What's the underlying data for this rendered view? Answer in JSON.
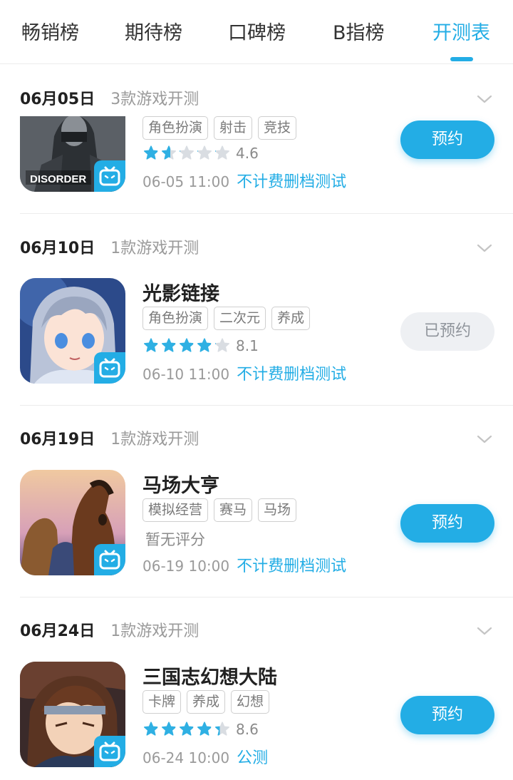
{
  "tabs": [
    {
      "label": "畅销榜",
      "active": false
    },
    {
      "label": "期待榜",
      "active": false
    },
    {
      "label": "口碑榜",
      "active": false
    },
    {
      "label": "B指榜",
      "active": false
    },
    {
      "label": "开测表",
      "active": true
    }
  ],
  "colors": {
    "accent": "#23ade5",
    "star_filled": "#2fb0e3",
    "star_empty": "#d9dde2"
  },
  "sections": [
    {
      "date": "06月05日",
      "count": "3款游戏开测",
      "games": [
        {
          "name": "",
          "tags": [
            "角色扮演",
            "射击",
            "竞技"
          ],
          "rating": 1.6,
          "score": "4.6",
          "time": "06-05 11:00",
          "test_type": "不计费删档测试",
          "button": "预约",
          "reserved": false,
          "icon": "disorder-game-icon"
        }
      ]
    },
    {
      "date": "06月10日",
      "count": "1款游戏开测",
      "games": [
        {
          "name": "光影链接",
          "tags": [
            "角色扮演",
            "二次元",
            "养成"
          ],
          "rating": 4.0,
          "score": "8.1",
          "time": "06-10 11:00",
          "test_type": "不计费删档测试",
          "button": "已预约",
          "reserved": true,
          "icon": "anime-girl-game-icon"
        }
      ]
    },
    {
      "date": "06月19日",
      "count": "1款游戏开测",
      "games": [
        {
          "name": "马场大亨",
          "tags": [
            "模拟经营",
            "赛马",
            "马场"
          ],
          "rating": null,
          "no_rating": "暂无评分",
          "time": "06-19 10:00",
          "test_type": "不计费删档测试",
          "button": "预约",
          "reserved": false,
          "icon": "horse-game-icon"
        }
      ]
    },
    {
      "date": "06月24日",
      "count": "1款游戏开测",
      "games": [
        {
          "name": "三国志幻想大陆",
          "tags": [
            "卡牌",
            "养成",
            "幻想"
          ],
          "rating": 4.3,
          "score": "8.6",
          "time": "06-24 10:00",
          "test_type": "公测",
          "button": "预约",
          "reserved": false,
          "icon": "warrior-game-icon"
        }
      ]
    }
  ],
  "icon_badge_text": "DISORDER"
}
